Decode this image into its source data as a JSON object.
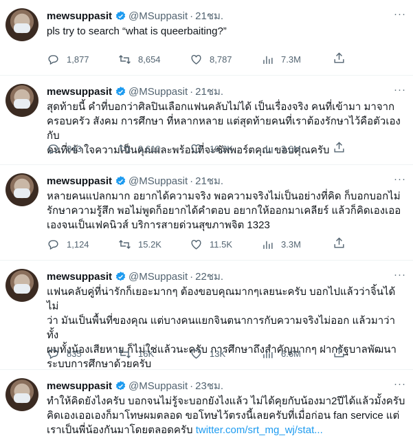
{
  "tweets": [
    {
      "name": "mewsuppasit",
      "handle": "@MSuppasit",
      "dot": "·",
      "time": "21ชม.",
      "text": "pls try to search “what is queerbaiting?”",
      "link": "",
      "replies": "1,877",
      "retweets": "8,654",
      "likes": "8,787",
      "views": "7.3M"
    },
    {
      "name": "mewsuppasit",
      "handle": "@MSuppasit",
      "dot": "·",
      "time": "21ชม.",
      "text": "สุดท้ายนี้ คำที่บอกว่าศิลปินเลือกแฟนคลับไม่ได้ เป็นเรื่องจริง คนที่เข้ามา มาจาก\nครอบครัว สังคม การศึกษา ที่หลากหลาย แต่สุดท้ายคนที่เราต้องรักษาไว้คือตัวเองกับ\nคนที่เข้าใจความเป็นคุณและพร้อมที่จะซัพพอร์ตคุณ ขอบคุณครับ",
      "link": "",
      "replies": "843",
      "retweets": "9,610",
      "likes": "10.2K",
      "views": "3.6M"
    },
    {
      "name": "mewsuppasit",
      "handle": "@MSuppasit",
      "dot": "·",
      "time": "21ชม.",
      "text": "หลายคนแปลกมาก อยากได้ความจริง พอความจริงไม่เป็นอย่างที่คิด ก็บอกบอกไม่\nรักษาความรู้สึก พอไม่พูดก็อยากได้คำตอบ อยากให้ออกมาเคลียร์ แล้วก็คิดเองเออ\nเองจนเป็นเฟคนิวส์ บริการสายด่วนสุขภาพจิต 1323",
      "link": "",
      "replies": "1,124",
      "retweets": "15.2K",
      "likes": "11.5K",
      "views": "3.3M"
    },
    {
      "name": "mewsuppasit",
      "handle": "@MSuppasit",
      "dot": "·",
      "time": "22ชม.",
      "text": "แฟนคลับคู่ที่น่ารักก็เยอะมากๆ ต้องขอบคุณมากๆเลยนะครับ บอกไปแล้วว่าจิ้นได้ ไม่\nว่า มันเป็นพื้นที่ของคุณ แต่บางคนแยกจินตนาการกับความจริงไม่ออก แล้วมาว่าทั้ง\nผมทั้งน้องเสียหาย ก็ไม่ใช่แล้วนะครับ การศึกษาถึงสำคัญมากๆ ฝากรัฐบาลพัฒนา\nระบบการศึกษาด้วยครับ",
      "link": "",
      "replies": "835",
      "retweets": "16K",
      "likes": "13K",
      "views": "6.6M"
    },
    {
      "name": "mewsuppasit",
      "handle": "@MSuppasit",
      "dot": "·",
      "time": "23ชม.",
      "text": "ทำให้คิดยังไงครับ บอกจนไม่รู้จะบอกยังไงแล้ว ไม่ได้คุยกับน้องมา2ปีได้แล้วมั้งครับ\nคิดเองเออเองก็มาโทษผมตลอด ขอโทษไว้ตรงนี้เลยครับที่เมื่อก่อน fan service แต่\nเราเป็นพี่น้องกันมาโดยตลอดครับ ",
      "link": "twitter.com/srt_mg_wj/stat...",
      "replies": "",
      "retweets": "",
      "likes": "",
      "views": ""
    }
  ],
  "more_label": "···",
  "colors": {
    "accent": "#1d9bf0",
    "muted": "#536471",
    "text": "#0f1419",
    "divider": "#eff3f4"
  },
  "icons": [
    "verified-badge-icon",
    "reply-icon",
    "retweet-icon",
    "like-icon",
    "views-icon",
    "share-icon",
    "more-icon"
  ]
}
